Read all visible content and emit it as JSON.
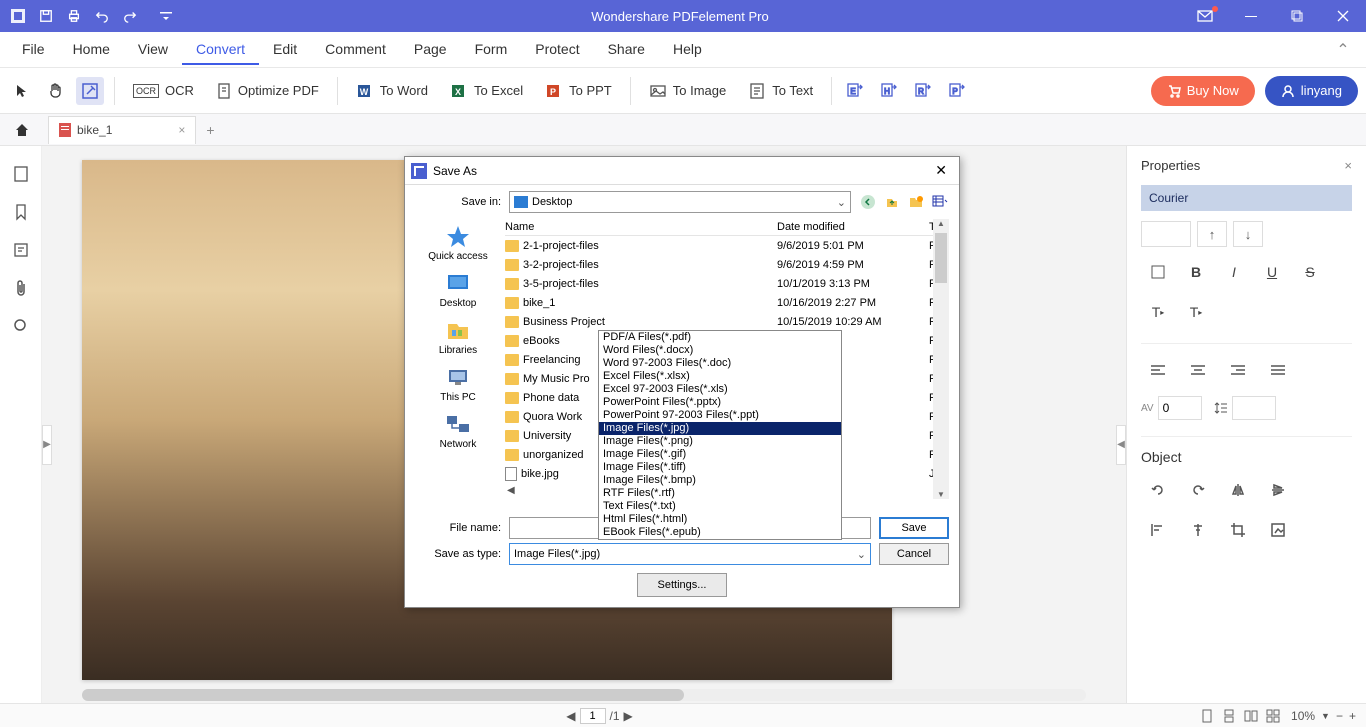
{
  "app_title": "Wondershare PDFelement Pro",
  "menu": [
    "File",
    "Home",
    "View",
    "Convert",
    "Edit",
    "Comment",
    "Page",
    "Form",
    "Protect",
    "Share",
    "Help"
  ],
  "menu_active_index": 3,
  "toolbar": {
    "ocr": "OCR",
    "optimize": "Optimize PDF",
    "to_word": "To Word",
    "to_excel": "To Excel",
    "to_ppt": "To PPT",
    "to_image": "To Image",
    "to_text": "To Text",
    "buy_now": "Buy Now",
    "user": "linyang"
  },
  "tab": {
    "label": "bike_1"
  },
  "properties": {
    "title": "Properties",
    "font": "Courier",
    "spacing_value": "0",
    "object_title": "Object"
  },
  "status": {
    "page_current": "1",
    "page_total": "/1",
    "zoom": "10%"
  },
  "dialog": {
    "title": "Save As",
    "save_in_label": "Save in:",
    "save_in_value": "Desktop",
    "places": [
      "Quick access",
      "Desktop",
      "Libraries",
      "This PC",
      "Network"
    ],
    "columns": {
      "name": "Name",
      "date": "Date modified",
      "type": "Ty"
    },
    "files": [
      {
        "name": "2-1-project-files",
        "date": "9/6/2019 5:01 PM",
        "type": "Fil",
        "kind": "folder"
      },
      {
        "name": "3-2-project-files",
        "date": "9/6/2019 4:59 PM",
        "type": "Fil",
        "kind": "folder"
      },
      {
        "name": "3-5-project-files",
        "date": "10/1/2019 3:13 PM",
        "type": "Fil",
        "kind": "folder"
      },
      {
        "name": "bike_1",
        "date": "10/16/2019 2:27 PM",
        "type": "Fil",
        "kind": "folder"
      },
      {
        "name": "Business Project",
        "date": "10/15/2019 10:29 AM",
        "type": "Fil",
        "kind": "folder"
      },
      {
        "name": "eBooks",
        "date": "37 PM",
        "type": "Fil",
        "kind": "folder"
      },
      {
        "name": "Freelancing",
        "date": "7 PM",
        "type": "Fil",
        "kind": "folder"
      },
      {
        "name": "My Music Pro",
        "date": "0 PM",
        "type": "Fil",
        "kind": "folder",
        "icon": "music"
      },
      {
        "name": "Phone data",
        "date": "11 PM",
        "type": "Fil",
        "kind": "folder"
      },
      {
        "name": "Quora Work",
        "date": "10 PM",
        "type": "Fil",
        "kind": "folder"
      },
      {
        "name": "University",
        "date": "38 PM",
        "type": "Fil",
        "kind": "folder"
      },
      {
        "name": "unorganized",
        "date": "39 PM",
        "type": "Fil",
        "kind": "folder"
      },
      {
        "name": "bike.jpg",
        "date": ":26 PM",
        "type": "JP",
        "kind": "file"
      }
    ],
    "file_name_label": "File name:",
    "file_name_value": "",
    "save_as_type_label": "Save as type:",
    "save_as_type_value": "Image Files(*.jpg)",
    "type_options": [
      "PDF/A Files(*.pdf)",
      "Word Files(*.docx)",
      "Word 97-2003 Files(*.doc)",
      "Excel Files(*.xlsx)",
      "Excel 97-2003 Files(*.xls)",
      "PowerPoint Files(*.pptx)",
      "PowerPoint 97-2003 Files(*.ppt)",
      "Image Files(*.jpg)",
      "Image Files(*.png)",
      "Image Files(*.gif)",
      "Image Files(*.tiff)",
      "Image Files(*.bmp)",
      "RTF Files(*.rtf)",
      "Text Files(*.txt)",
      "Html Files(*.html)",
      "EBook Files(*.epub)"
    ],
    "type_selected_index": 7,
    "save_btn": "Save",
    "cancel_btn": "Cancel",
    "settings_btn": "Settings..."
  }
}
